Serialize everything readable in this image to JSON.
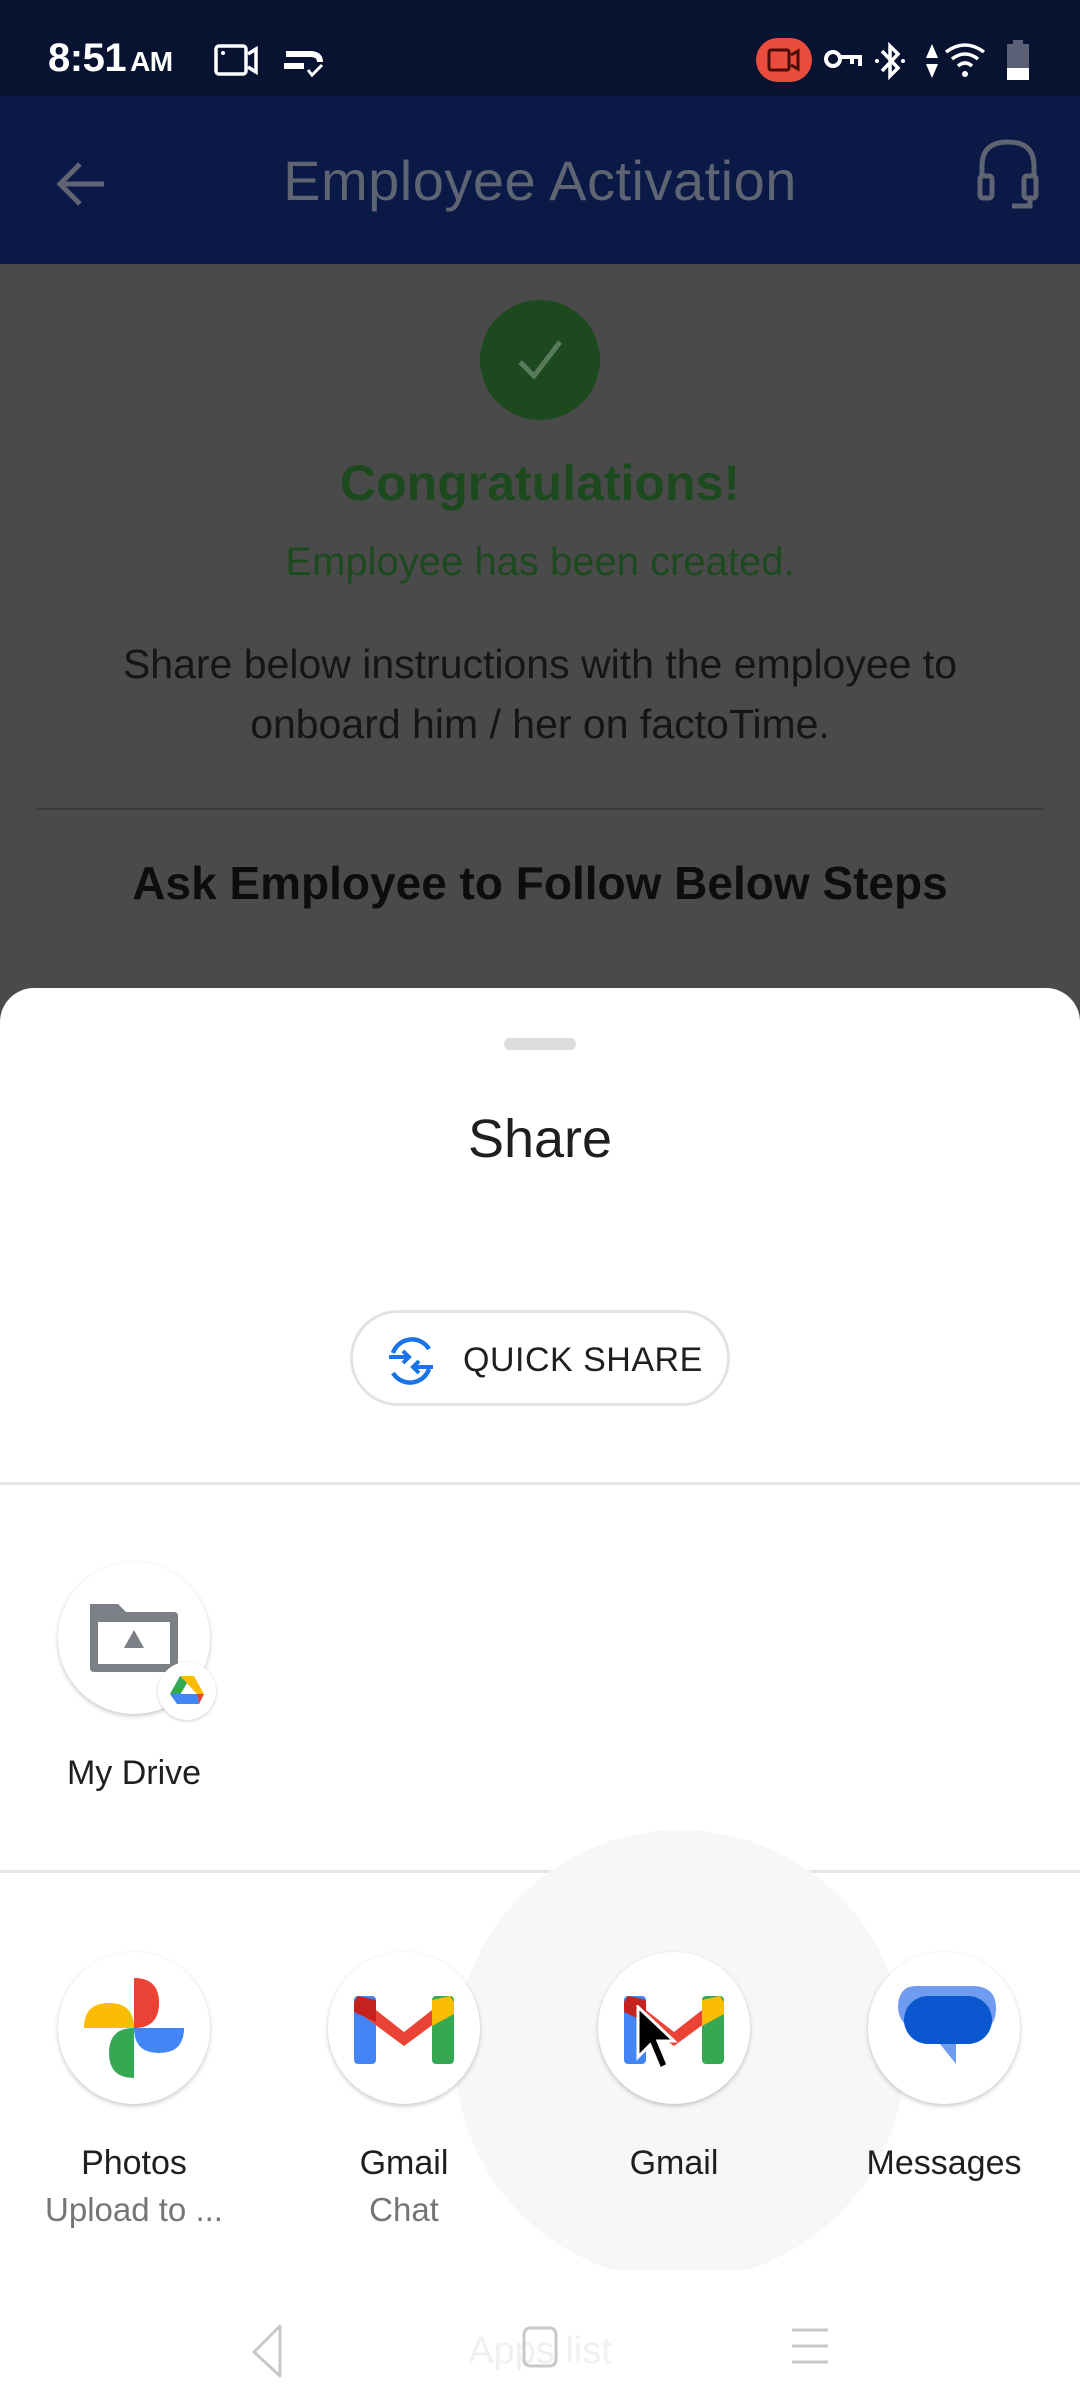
{
  "status_bar": {
    "time": "8:51",
    "ampm": "AM",
    "left_icons": [
      "screen-record-icon",
      "sync-check-icon"
    ],
    "right_icons": [
      "recording-indicator-icon",
      "vpn-key-icon",
      "bluetooth-icon",
      "data-arrows-icon",
      "wifi-icon",
      "battery-icon"
    ]
  },
  "header": {
    "title": "Employee Activation",
    "back_icon": "arrow-left-icon",
    "support_icon": "headset-icon"
  },
  "content": {
    "success_icon": "check-icon",
    "congrats": "Congratulations!",
    "created": "Employee has been created.",
    "instructions": "Share below instructions with the employee to onboard him / her on factoTime.",
    "steps_title": "Ask Employee to Follow Below Steps",
    "accent_color": "#1c4a1e"
  },
  "share_sheet": {
    "title": "Share",
    "quick_share_label": "QUICK SHARE",
    "direct_targets": [
      {
        "label": "My Drive",
        "icon": "drive-folder-icon"
      }
    ],
    "apps": [
      {
        "label": "Photos",
        "sublabel": "Upload to ...",
        "icon": "google-photos-icon"
      },
      {
        "label": "Gmail",
        "sublabel": "Chat",
        "icon": "gmail-icon"
      },
      {
        "label": "Gmail",
        "sublabel": "",
        "icon": "gmail-icon"
      },
      {
        "label": "Messages",
        "sublabel": "",
        "icon": "messages-icon"
      }
    ]
  },
  "nav_bar": {
    "hint": "Apps list",
    "buttons": [
      "back",
      "home",
      "recents"
    ]
  }
}
